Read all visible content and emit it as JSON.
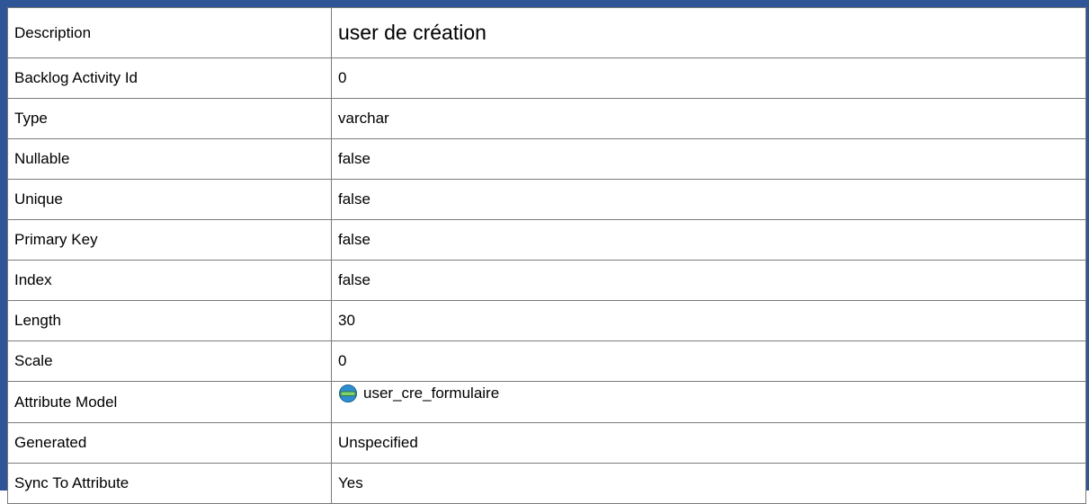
{
  "rows": [
    {
      "label": "Description",
      "value": "user de création"
    },
    {
      "label": "Backlog Activity Id",
      "value": "0"
    },
    {
      "label": "Type",
      "value": "varchar"
    },
    {
      "label": "Nullable",
      "value": "false"
    },
    {
      "label": "Unique",
      "value": "false"
    },
    {
      "label": "Primary Key",
      "value": "false"
    },
    {
      "label": "Index",
      "value": "false"
    },
    {
      "label": "Length",
      "value": "30"
    },
    {
      "label": "Scale",
      "value": "0"
    },
    {
      "label": "Attribute Model",
      "value": "user_cre_formulaire",
      "icon": "attribute-model-icon"
    },
    {
      "label": "Generated",
      "value": "Unspecified"
    },
    {
      "label": "Sync To Attribute",
      "value": "Yes"
    }
  ],
  "colors": {
    "frame": "#2f5597",
    "border": "#7a7a7a",
    "icon_fill": "#2e8fd0",
    "icon_band": "#7cd36f"
  }
}
